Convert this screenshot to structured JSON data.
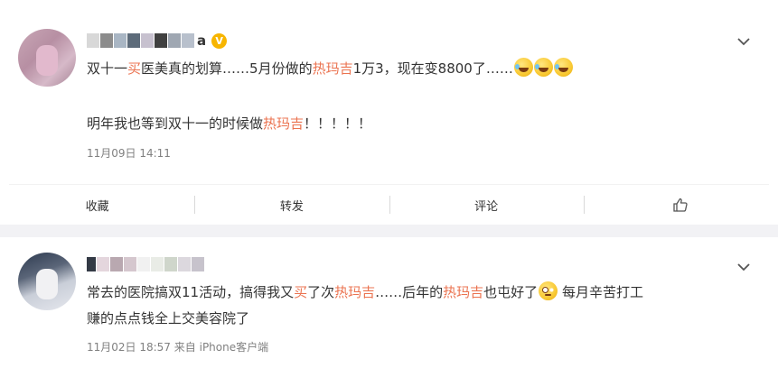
{
  "posts": [
    {
      "username_visible": "a",
      "text_line1": [
        {
          "t": "双十一",
          "hl": false
        },
        {
          "t": "买",
          "hl": true
        },
        {
          "t": "医美真的划算……5月份做的",
          "hl": false
        },
        {
          "t": "热玛吉",
          "hl": true
        },
        {
          "t": "1万3，现在变8800了……",
          "hl": false
        }
      ],
      "emojis_line1": [
        "laugh-cry",
        "laugh-cry",
        "laugh-cry"
      ],
      "text_line2": [
        {
          "t": "明年我也等到双十一的时候做",
          "hl": false
        },
        {
          "t": "热玛吉",
          "hl": true
        },
        {
          "t": "！！！！！",
          "hl": false
        }
      ],
      "date": "11月09日 14:11",
      "source": ""
    },
    {
      "username_visible": "",
      "text_line1": [
        {
          "t": "常去的医院搞双11活动，搞得我又",
          "hl": false
        },
        {
          "t": "买",
          "hl": true
        },
        {
          "t": "了次",
          "hl": false
        },
        {
          "t": "热玛吉",
          "hl": true
        },
        {
          "t": "……后年的",
          "hl": false
        },
        {
          "t": "热玛吉",
          "hl": true
        },
        {
          "t": "也屯好了",
          "hl": false
        }
      ],
      "emoji_inline": "eye-roll",
      "text_line1_tail": " 每月辛苦打工",
      "text_line2": "赚的点点钱全上交美容院了",
      "date": "11月02日 18:57",
      "source_prefix": "来自",
      "source": "iPhone客户端"
    }
  ],
  "action_bar": {
    "favorite_label": "收藏",
    "repost_label": "转发",
    "comment_label": "评论"
  },
  "icons": {
    "badge": "vip-verified-icon",
    "more": "chevron-down-icon",
    "like": "thumbs-up-icon"
  },
  "colors": {
    "highlight": "#eb7350",
    "text": "#333333",
    "meta": "#808080",
    "badge": "#f7b500"
  }
}
